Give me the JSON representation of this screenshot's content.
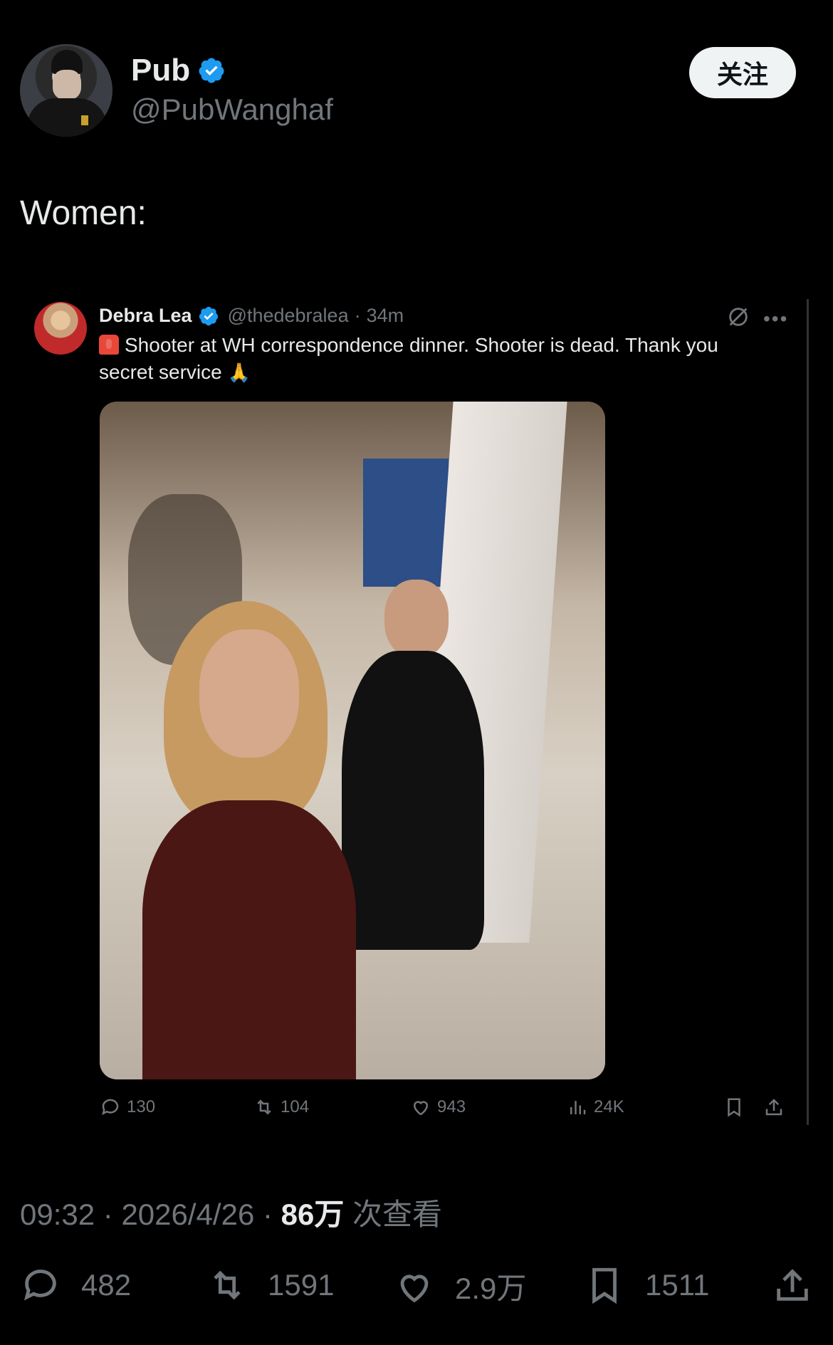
{
  "author": {
    "name": "Pub",
    "handle": "@PubWanghaf",
    "follow_label": "关注"
  },
  "tweet": {
    "text": "Women:"
  },
  "quote": {
    "name": "Debra Lea",
    "handle": "@thedebralea",
    "dot": "·",
    "time": "34m",
    "text": "Shooter at WH correspondence dinner. Shooter is dead. Thank you secret service",
    "stats": {
      "replies": "130",
      "reposts": "104",
      "likes": "943",
      "views": "24K"
    }
  },
  "meta": {
    "time": "09:32",
    "sep1": "·",
    "date": "2026/4/26",
    "sep2": "·",
    "views": "86万",
    "views_suffix": "次查看"
  },
  "stats": {
    "replies": "482",
    "reposts": "1591",
    "likes": "2.9万",
    "bookmarks": "1511"
  },
  "colors": {
    "background": "#000000",
    "verified": "#1d9bf0",
    "muted": "#71767b",
    "text": "#e7e9ea"
  }
}
